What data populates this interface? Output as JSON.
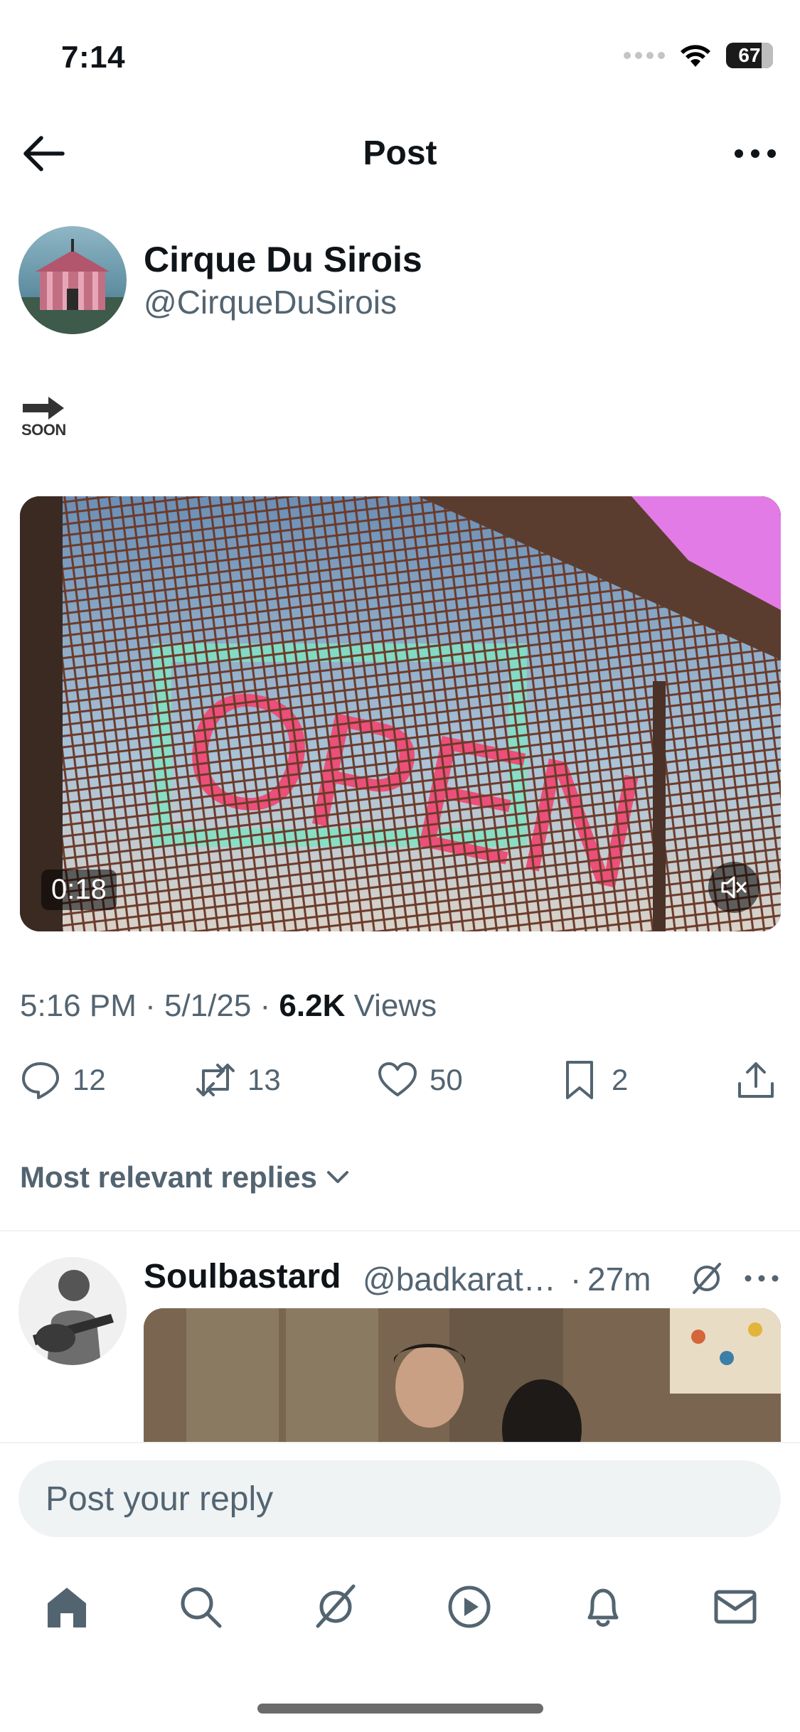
{
  "status_bar": {
    "time": "7:14",
    "battery": "67"
  },
  "header": {
    "title": "Post"
  },
  "author": {
    "name": "Cirque Du Sirois",
    "handle": "@CirqueDuSirois"
  },
  "post": {
    "icon_text": "SOON",
    "video_duration": "0:18",
    "meta_time": "5:16 PM · 5/1/25 · ",
    "meta_views_count": "6.2K",
    "meta_views_label": " Views"
  },
  "actions": {
    "replies": "12",
    "reposts": "13",
    "likes": "50",
    "bookmarks": "2"
  },
  "replies_sort": {
    "label": "Most relevant replies"
  },
  "reply": {
    "name": "Soulbastard",
    "handle": "@badkarat…",
    "dot": "·",
    "time": "27m"
  },
  "reply_input": {
    "placeholder": "Post your reply"
  },
  "colors": {
    "text": "#0f1419",
    "secondary": "#536471",
    "divider": "#eff3f4",
    "input_bg": "#eff3f4"
  }
}
